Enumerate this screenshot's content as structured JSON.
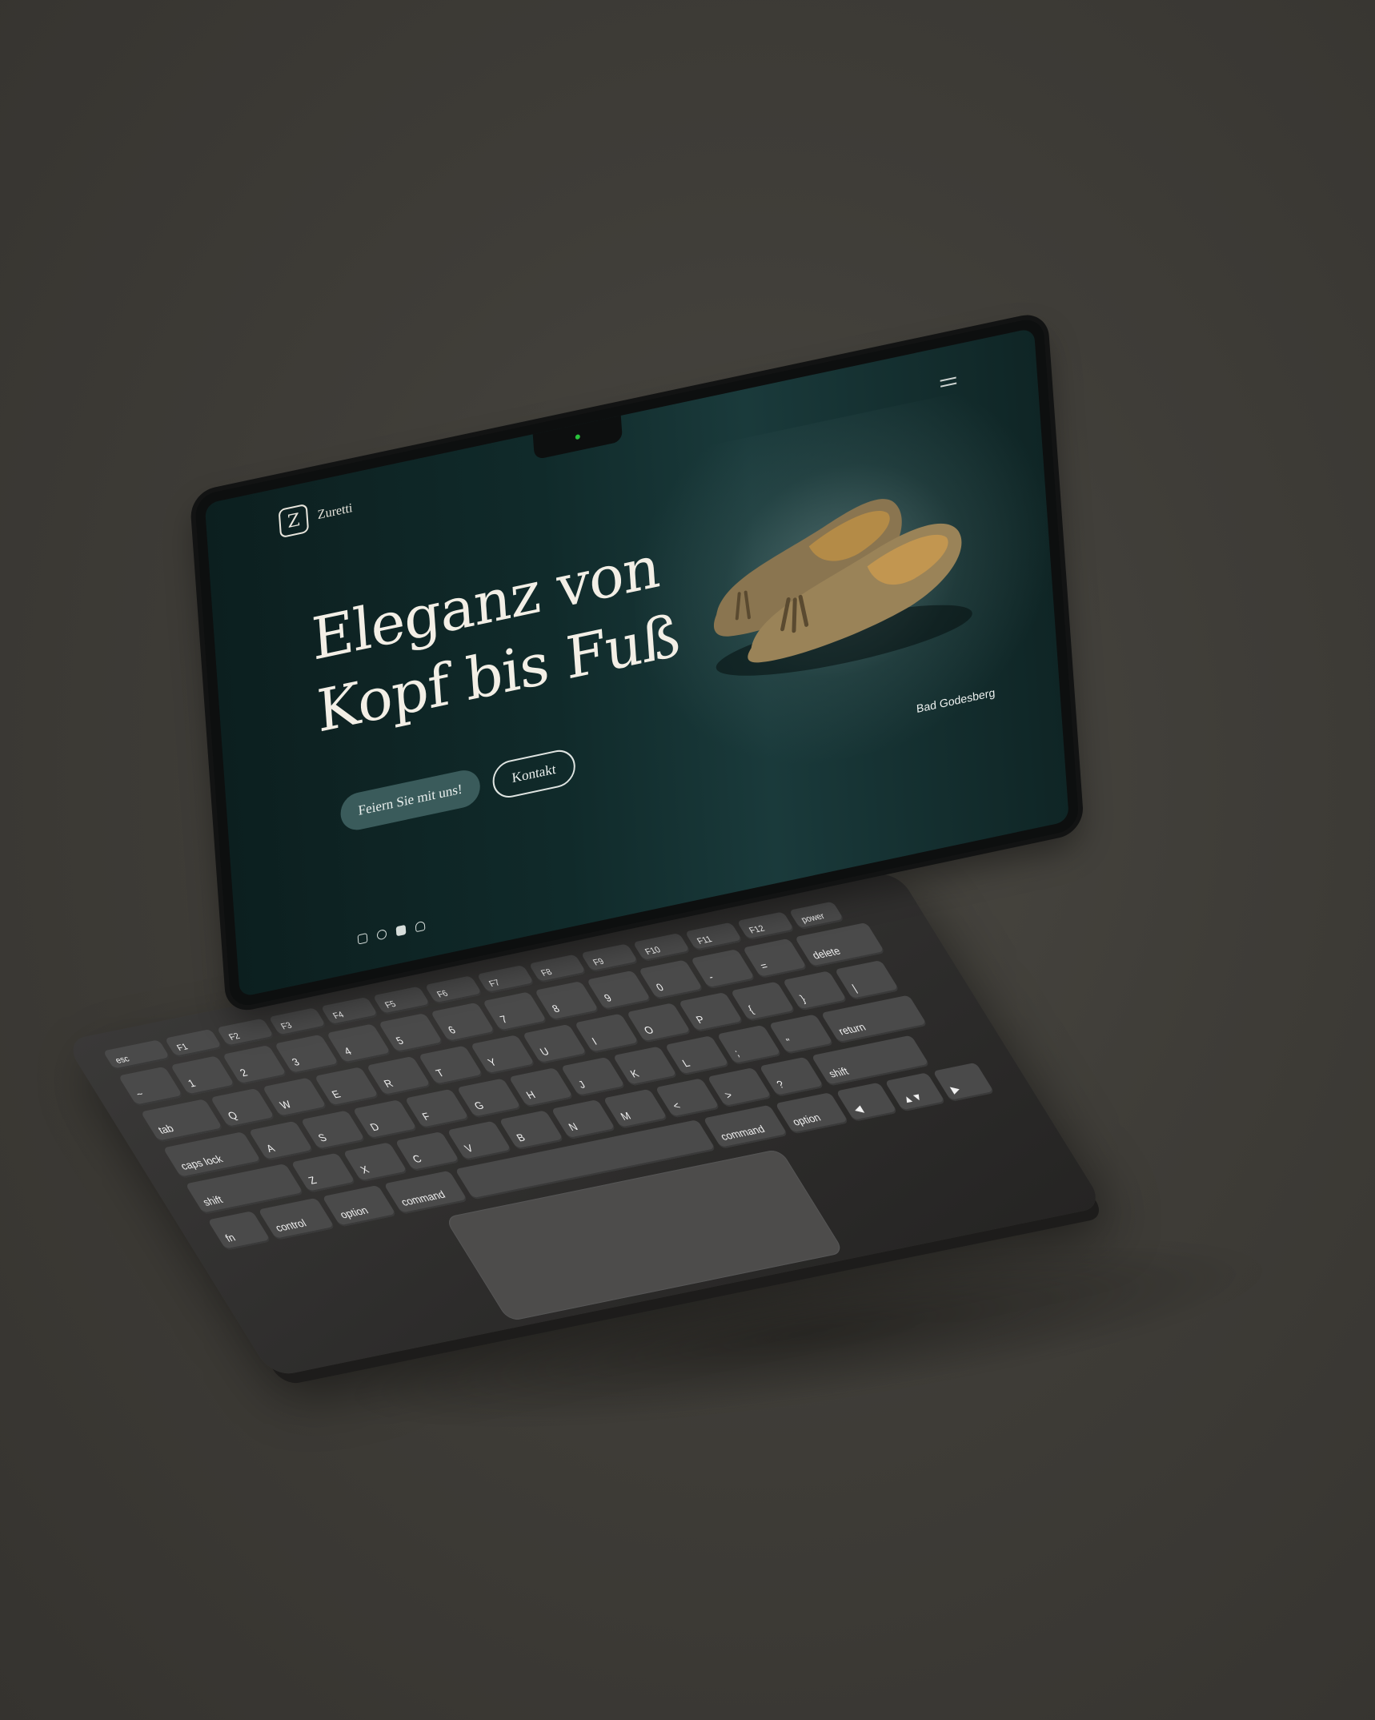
{
  "site": {
    "brand_mark": "Z",
    "brand_name": "Zuretti",
    "headline": [
      "Eleganz von",
      "Kopf bis Fuß"
    ],
    "cta_primary": "Feiern Sie mit uns!",
    "cta_secondary": "Kontakt",
    "location": "Bad Godesberg",
    "social_icons": [
      "instagram-icon",
      "facebook-icon",
      "youtube-icon",
      "snapchat-icon"
    ]
  },
  "keyboard": {
    "rows": [
      [
        "esc",
        "F1",
        "F2",
        "F3",
        "F4",
        "F5",
        "F6",
        "F7",
        "F8",
        "F9",
        "F10",
        "F11",
        "F12",
        "power"
      ],
      [
        "~",
        "1",
        "2",
        "3",
        "4",
        "5",
        "6",
        "7",
        "8",
        "9",
        "0",
        "-",
        "=",
        "delete"
      ],
      [
        "tab",
        "Q",
        "W",
        "E",
        "R",
        "T",
        "Y",
        "U",
        "I",
        "O",
        "P",
        "{",
        "}",
        "|"
      ],
      [
        "caps lock",
        "A",
        "S",
        "D",
        "F",
        "G",
        "H",
        "J",
        "K",
        "L",
        ";",
        "\"",
        "return"
      ],
      [
        "shift",
        "Z",
        "X",
        "C",
        "V",
        "B",
        "N",
        "M",
        "<",
        ">",
        "?",
        "shift"
      ],
      [
        "fn",
        "control",
        "option",
        "command",
        "",
        "command",
        "option",
        "◀",
        "▲▼",
        "▶"
      ]
    ]
  },
  "colors": {
    "background": "#3f3d38",
    "screen_bg": "#0f2525",
    "accent": "#3a5b5b",
    "text_light": "#f3efe6"
  }
}
